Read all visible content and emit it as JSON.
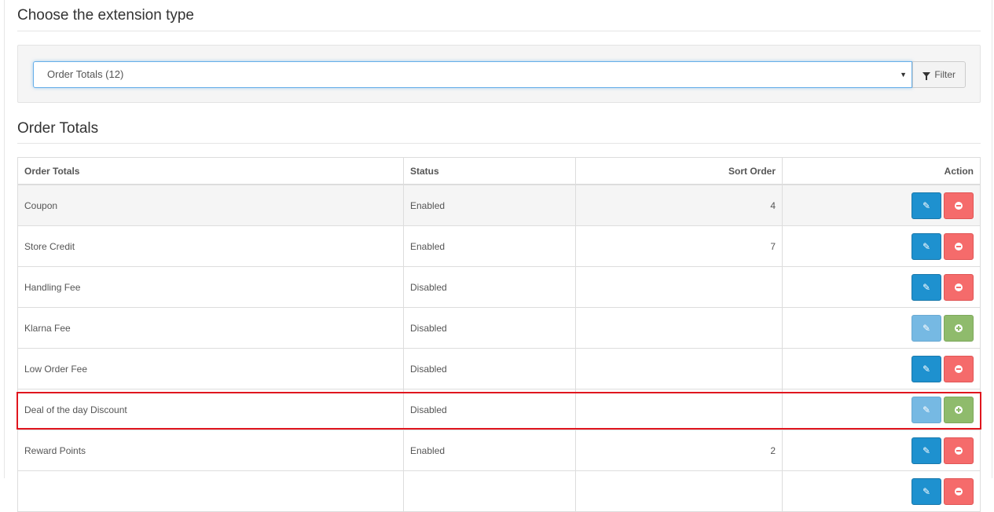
{
  "header": {
    "title": "Choose the extension type"
  },
  "filter": {
    "selected": "Order Totals (12)",
    "button_label": "Filter",
    "caret_glyph": "▼",
    "icon": "filter-icon"
  },
  "section": {
    "title": "Order Totals"
  },
  "table": {
    "columns": [
      "Order Totals",
      "Status",
      "Sort Order",
      "Action"
    ],
    "rows": [
      {
        "name": "Coupon",
        "status": "Enabled",
        "sort": "4",
        "installed": true
      },
      {
        "name": "Store Credit",
        "status": "Enabled",
        "sort": "7",
        "installed": true
      },
      {
        "name": "Handling Fee",
        "status": "Disabled",
        "sort": "",
        "installed": true
      },
      {
        "name": "Klarna Fee",
        "status": "Disabled",
        "sort": "",
        "installed": false
      },
      {
        "name": "Low Order Fee",
        "status": "Disabled",
        "sort": "",
        "installed": true
      },
      {
        "name": "Deal of the day Discount",
        "status": "Disabled",
        "sort": "",
        "installed": false
      },
      {
        "name": "Reward Points",
        "status": "Enabled",
        "sort": "2",
        "installed": true
      },
      {
        "name": "",
        "status": "",
        "sort": "",
        "installed": true
      }
    ]
  },
  "highlight_color": "#e0161e",
  "colors": {
    "edit": "#1e91cf",
    "uninstall": "#f56b6b",
    "install": "#8fbb6c"
  }
}
